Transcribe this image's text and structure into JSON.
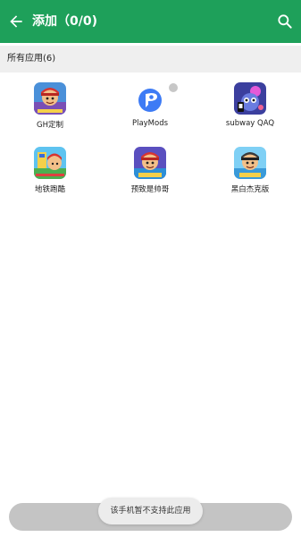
{
  "header": {
    "title": "添加（0/0)",
    "back_icon": "arrow-left-icon",
    "search_icon": "search-icon",
    "color": "#1ea05a"
  },
  "section": {
    "label": "所有应用(6)"
  },
  "apps": [
    {
      "label": "GH定制"
    },
    {
      "label": "PlayMods"
    },
    {
      "label": "subway QAQ"
    },
    {
      "label": "地铁跑酷"
    },
    {
      "label": "预致是帅哥"
    },
    {
      "label": "黑白杰克版"
    }
  ],
  "toast": {
    "message": "该手机暂不支持此应用"
  }
}
